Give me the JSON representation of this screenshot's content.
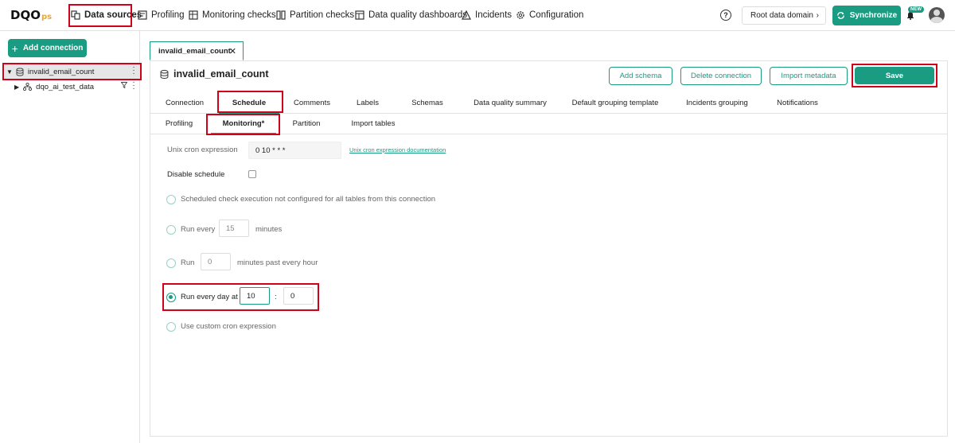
{
  "nav": {
    "logo_main": "DQO",
    "logo_suffix": "ps",
    "items": [
      {
        "label": "Data sources",
        "icon": "data-sources-icon"
      },
      {
        "label": "Profiling",
        "icon": "profiling-icon"
      },
      {
        "label": "Monitoring checks",
        "icon": "monitoring-icon"
      },
      {
        "label": "Partition checks",
        "icon": "partition-icon"
      },
      {
        "label": "Data quality dashboards",
        "icon": "dashboards-icon"
      },
      {
        "label": "Incidents",
        "icon": "warning-icon"
      },
      {
        "label": "Configuration",
        "icon": "gear-icon"
      }
    ],
    "help_label": "?",
    "domain_label": "Root data domain",
    "sync_label": "Synchronize",
    "new_badge": "NEW"
  },
  "sidebar": {
    "add_connection_label": "Add connection",
    "connection_name": "invalid_email_count",
    "schema_name": "dqo_ai_test_data"
  },
  "main": {
    "open_tab_label": "invalid_email_count",
    "title": "invalid_email_count",
    "buttons": {
      "add_schema": "Add schema",
      "delete_connection": "Delete connection",
      "import_metadata": "Import metadata",
      "save": "Save"
    },
    "tabs": [
      "Connection",
      "Schedule",
      "Comments",
      "Labels",
      "Schemas",
      "Data quality summary",
      "Default grouping template",
      "Incidents grouping",
      "Notifications"
    ],
    "subtabs": [
      "Profiling",
      "Monitoring*",
      "Partition",
      "Import tables"
    ],
    "active_tab": "Schedule",
    "active_subtab": "Monitoring*"
  },
  "schedule": {
    "cron_label": "Unix cron expression",
    "cron_value": "0 10 * * *",
    "cron_doc_link": "Unix cron expression documentation",
    "disable_label": "Disable schedule",
    "disable_checked": false,
    "option_not_configured": "Scheduled check execution not configured for all tables from this connection",
    "option_run_every": "Run every",
    "run_every_value": "15",
    "run_every_unit": "minutes",
    "option_run": "Run",
    "run_minutes_value": "0",
    "run_minutes_unit": "minutes past every hour",
    "option_daily": "Run every day at",
    "daily_hour": "10",
    "daily_separator": ":",
    "daily_minute": "0",
    "option_custom": "Use custom cron expression",
    "selected_option": "daily"
  },
  "colors": {
    "accent": "#1a9c82",
    "highlight": "#d0021b"
  }
}
